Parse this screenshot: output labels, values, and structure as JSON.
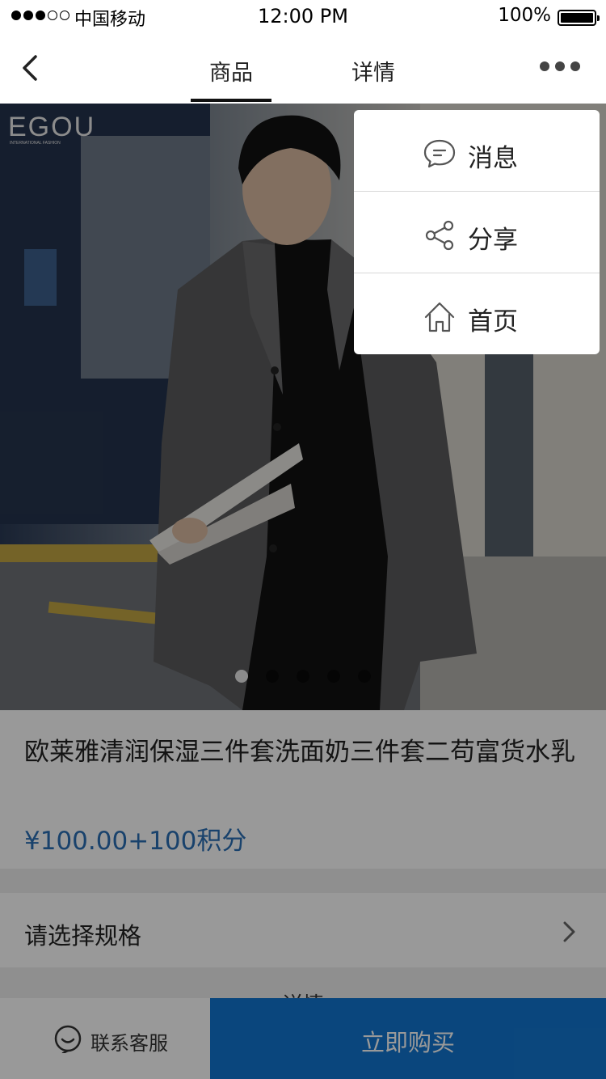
{
  "status_bar": {
    "carrier": "中国移动",
    "time": "12:00 PM",
    "battery": "100%",
    "signal_bars": 3
  },
  "nav": {
    "tabs": [
      {
        "label": "商品",
        "active": true
      },
      {
        "label": "详情",
        "active": false
      }
    ]
  },
  "hero": {
    "brand_watermark": "EGOU",
    "brand_sub": "INTERNATIONAL FASHION",
    "pager_count": 5,
    "pager_active": 1
  },
  "product": {
    "title": "欧莱雅清润保湿三件套洗面奶三件套二苟富货水乳",
    "price": "¥100.00+100积分"
  },
  "spec": {
    "label": "请选择规格"
  },
  "detail_section": {
    "label": "详情"
  },
  "bottom": {
    "service_label": "联系客服",
    "buy_label": "立即购买"
  },
  "menu": {
    "items": [
      {
        "label": "消息",
        "icon": "message-icon"
      },
      {
        "label": "分享",
        "icon": "share-icon"
      },
      {
        "label": "首页",
        "icon": "home-icon"
      }
    ]
  },
  "colors": {
    "accent": "#1276d0",
    "price": "#2b6fb5",
    "overlay": "rgba(0,0,0,0.40)"
  }
}
